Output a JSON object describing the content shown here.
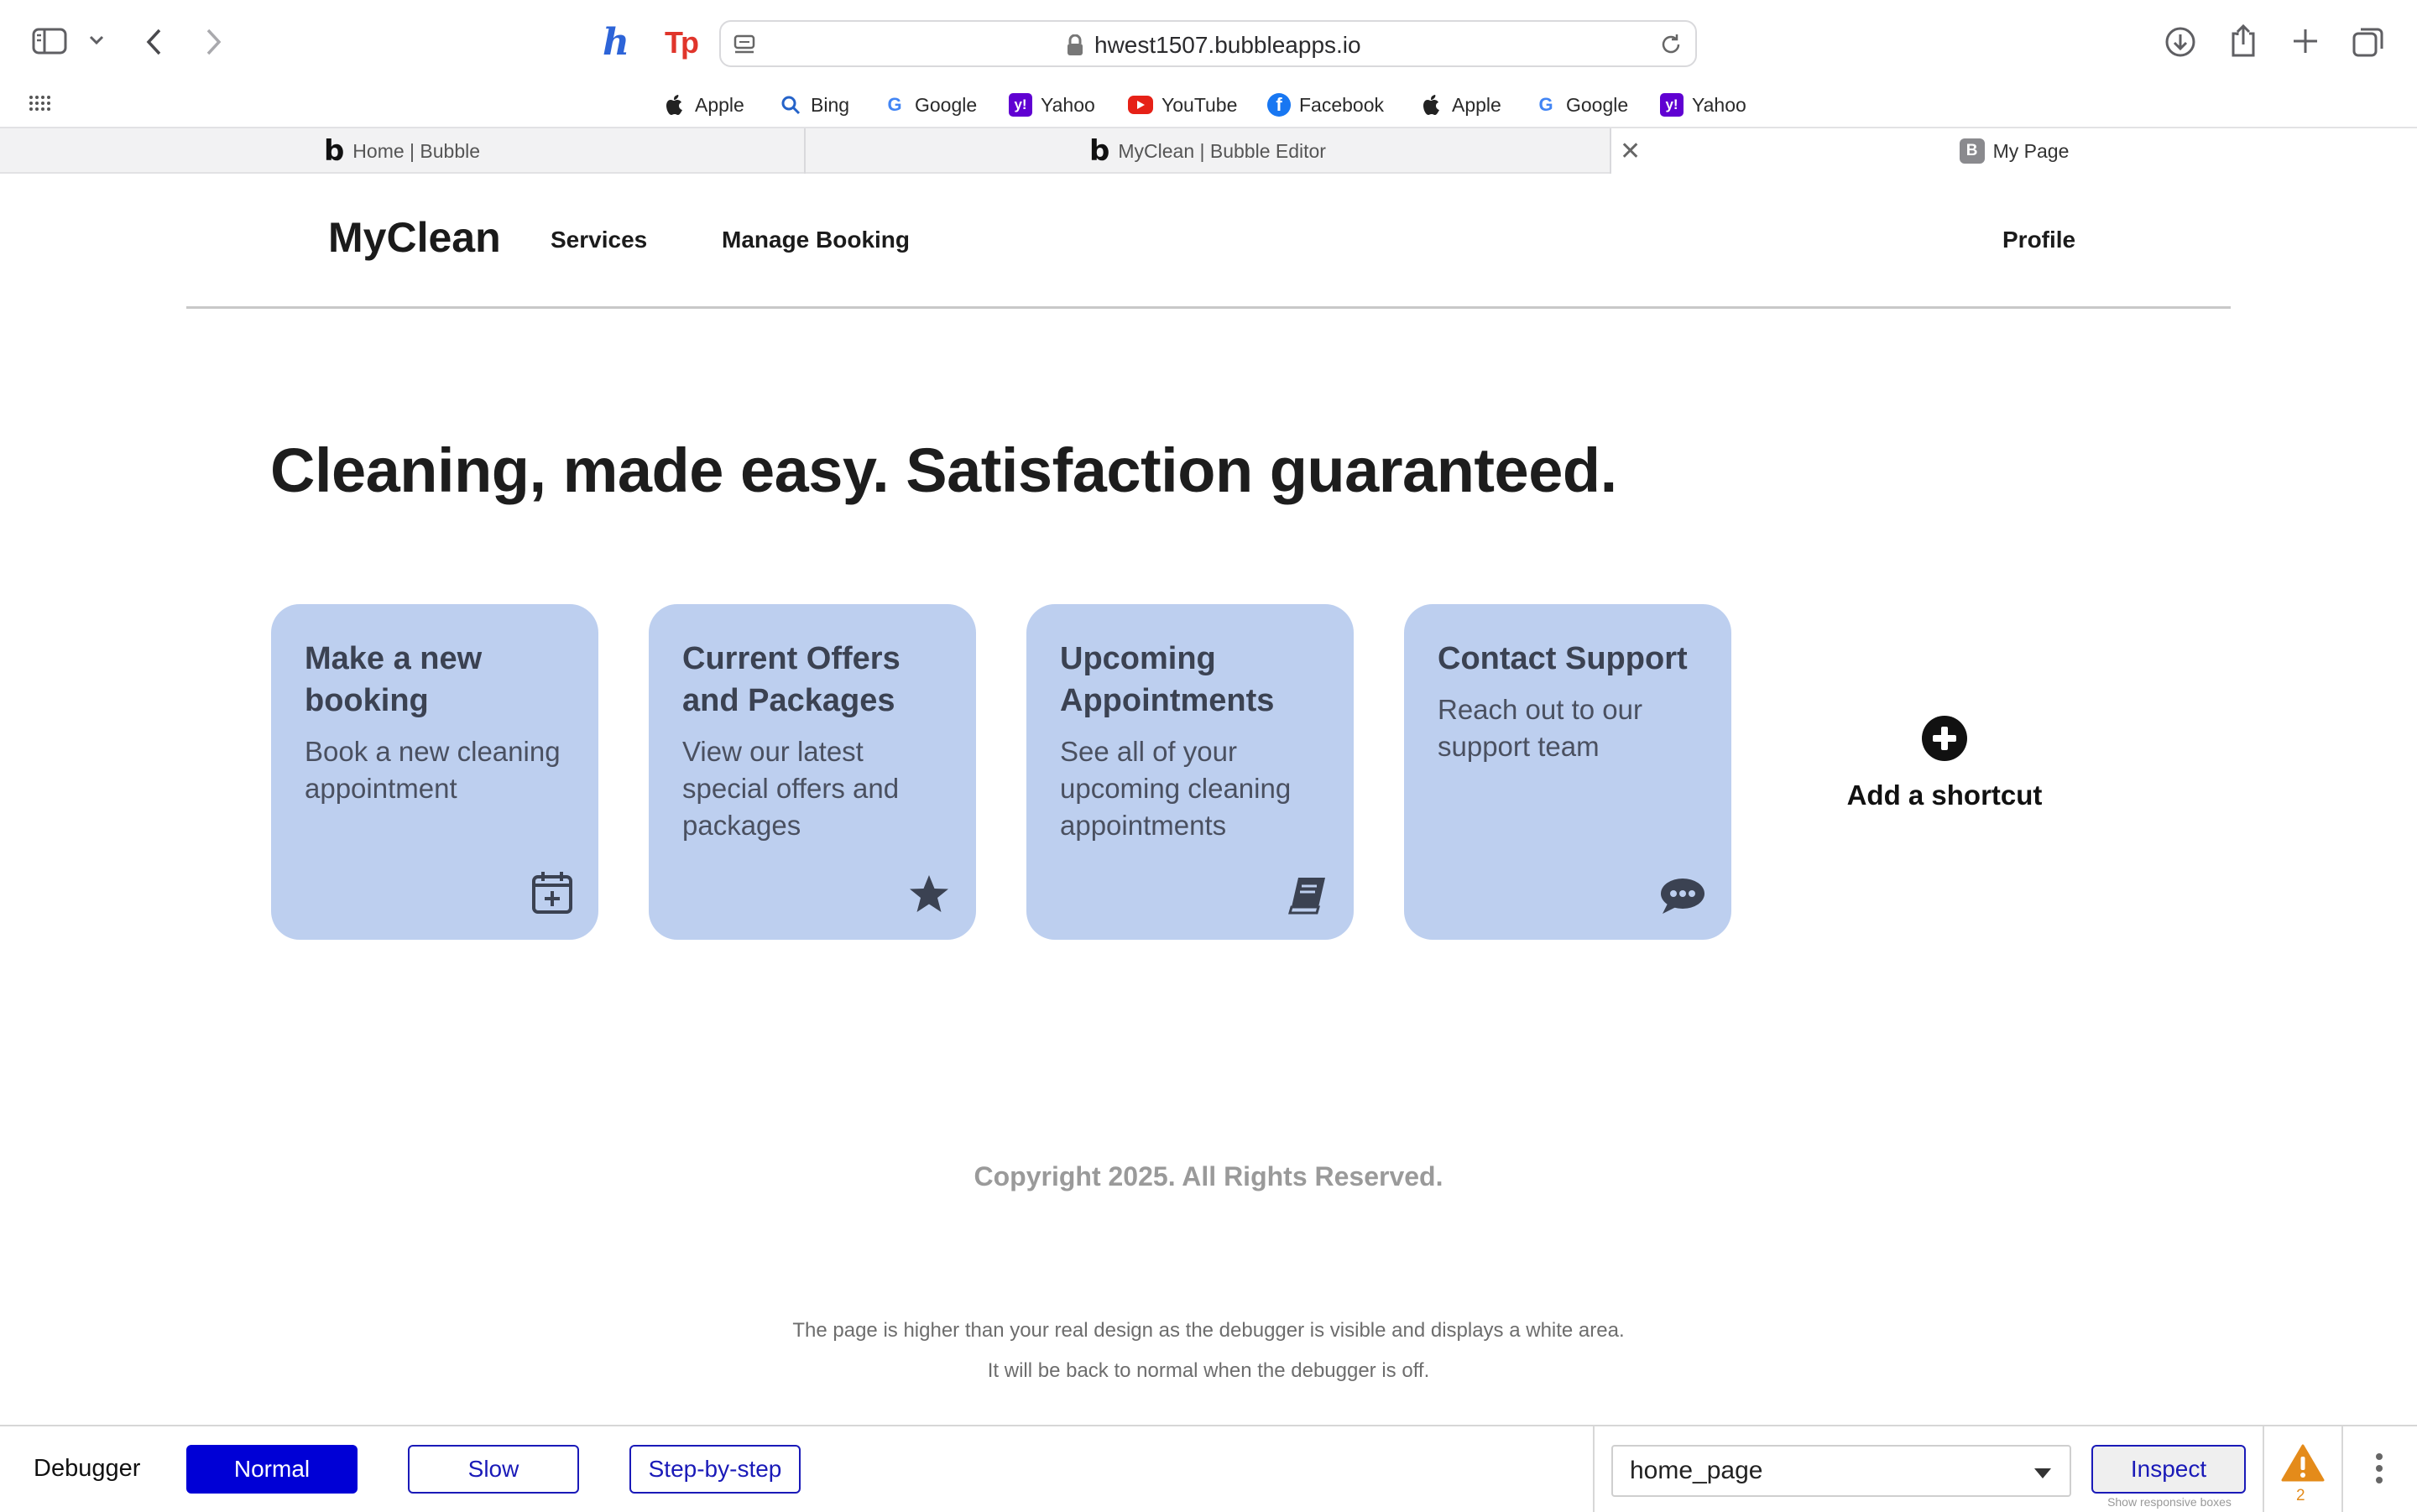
{
  "browser": {
    "url": "hwest1507.bubbleapps.io",
    "bookmarks": [
      "Apple",
      "Bing",
      "Google",
      "Yahoo",
      "YouTube",
      "Facebook",
      "Apple",
      "Google",
      "Yahoo"
    ],
    "extensions": {
      "h": "h",
      "tp": "Tp"
    },
    "tabs": [
      {
        "title": "Home | Bubble"
      },
      {
        "title": "MyClean | Bubble Editor"
      },
      {
        "title": "My Page",
        "favicon_letter": "B"
      }
    ]
  },
  "header": {
    "brand": "MyClean",
    "nav": {
      "services": "Services",
      "manage_booking": "Manage Booking",
      "profile": "Profile"
    }
  },
  "hero": {
    "title": "Cleaning, made easy. Satisfaction guaranteed."
  },
  "cards": [
    {
      "title": "Make a new booking",
      "description": "Book a new cleaning appointment",
      "icon": "calendar-plus-icon"
    },
    {
      "title": "Current Offers and Packages",
      "description": "View our latest special offers and packages",
      "icon": "star-icon"
    },
    {
      "title": "Upcoming Appointments",
      "description": "See all of your upcoming cleaning appointments",
      "icon": "book-icon"
    },
    {
      "title": "Contact Support",
      "description": "Reach out to our support team",
      "icon": "chat-bubble-icon"
    }
  ],
  "shortcut": {
    "label": "Add a shortcut"
  },
  "footer": {
    "copyright": "Copyright 2025. All Rights Reserved."
  },
  "debugger_note": {
    "line1": "The page is higher than your real design as the debugger is visible and displays a white area.",
    "line2": "It will be back to normal when the debugger is off."
  },
  "debugger": {
    "label": "Debugger",
    "modes": [
      "Normal",
      "Slow",
      "Step-by-step"
    ],
    "active_mode": "Normal",
    "page_select": "home_page",
    "inspect": "Inspect",
    "responsive_note": "Show responsive boxes",
    "warning_count": "2"
  },
  "colors": {
    "card_bg": "#bdcfef",
    "debugger_active": "#0000d6",
    "debugger_accent": "#1a1ab8",
    "warning": "#e48b1a"
  }
}
